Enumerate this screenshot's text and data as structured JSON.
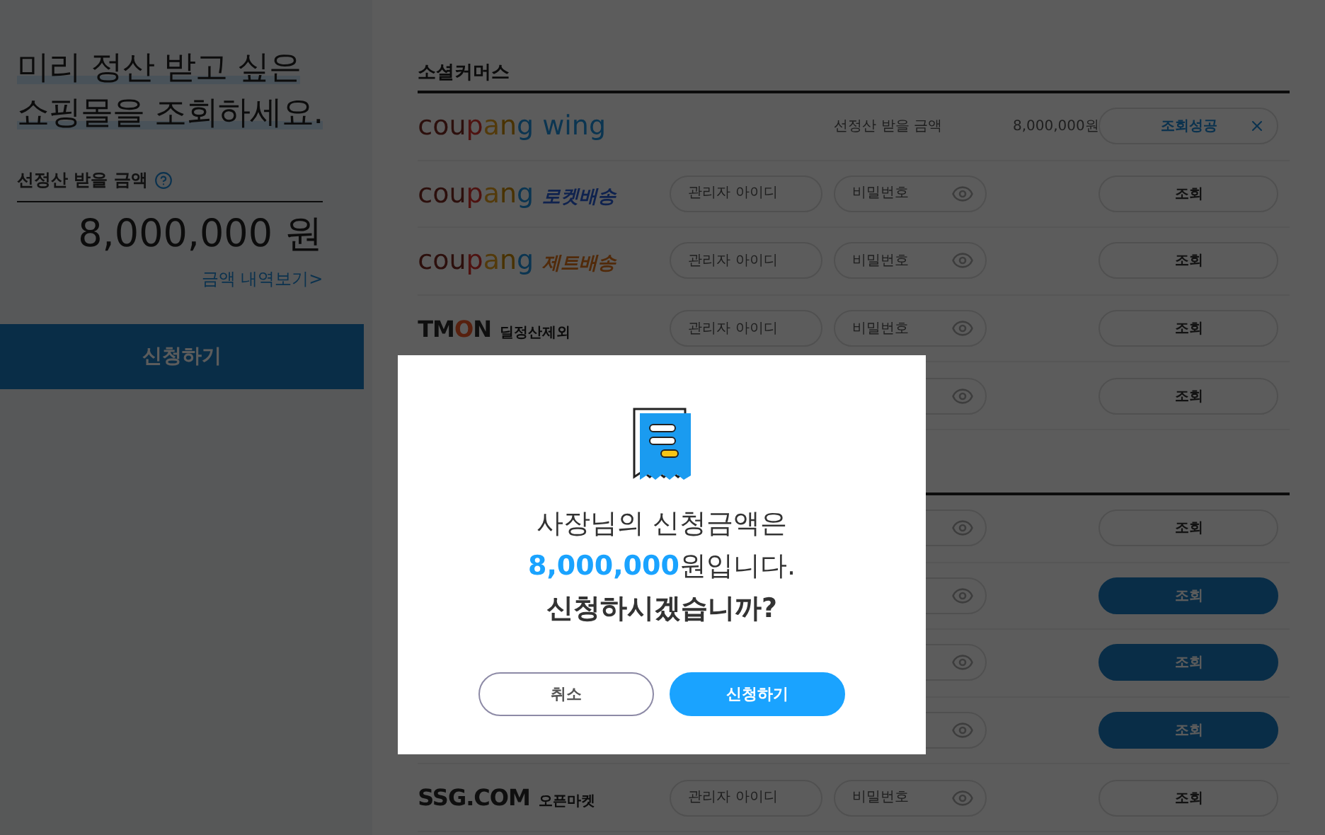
{
  "sidebar": {
    "title_lines": [
      "미리 정산 받고 싶은",
      "쇼핑몰을 조회하세요."
    ],
    "amount_label": "선정산 받을 금액",
    "amount": "8,000,000 원",
    "details_link": "금액 내역보기>",
    "apply_button": "신청하기"
  },
  "sections": [
    {
      "title": "소셜커머스",
      "rows": [
        {
          "kind": "result",
          "logo": {
            "kind": "coupang",
            "name": "coupang",
            "tag": {
              "kind": "wing",
              "text": "wing"
            }
          },
          "label": "선정산 받을 금액",
          "amount": "8,000,000원",
          "button": "조회성공",
          "highlighted": false
        },
        {
          "kind": "login",
          "logo": {
            "kind": "coupang",
            "name": "coupang",
            "tag": {
              "kind": "rocket",
              "text": "로켓배송"
            }
          },
          "id_placeholder": "관리자 아이디",
          "pw_placeholder": "비밀번호",
          "button": "조회",
          "highlighted": false
        },
        {
          "kind": "login",
          "logo": {
            "kind": "coupang",
            "name": "coupang",
            "tag": {
              "kind": "jet",
              "text": "제트배송"
            }
          },
          "id_placeholder": "관리자 아이디",
          "pw_placeholder": "비밀번호",
          "button": "조회",
          "highlighted": false
        },
        {
          "kind": "login",
          "logo": {
            "kind": "tmon",
            "name": "TMON",
            "tag": {
              "kind": "plain",
              "text": "딜정산제외"
            }
          },
          "id_placeholder": "관리자 아이디",
          "pw_placeholder": "비밀번호",
          "button": "조회",
          "highlighted": false
        },
        {
          "kind": "login",
          "button": "조회",
          "highlighted": false
        }
      ]
    },
    {
      "rows": [
        {
          "kind": "login",
          "button": "조회",
          "highlighted": false
        },
        {
          "kind": "login",
          "button": "조회",
          "highlighted": true
        },
        {
          "kind": "login",
          "button": "조회",
          "highlighted": true
        },
        {
          "kind": "login",
          "button": "조회",
          "highlighted": true
        },
        {
          "kind": "login",
          "logo": {
            "kind": "ssg",
            "name": "SSG.COM",
            "tag": {
              "kind": "plain",
              "text": "오픈마켓"
            }
          },
          "id_placeholder": "관리자 아이디",
          "pw_placeholder": "비밀번호",
          "button": "조회",
          "highlighted": false
        }
      ]
    }
  ],
  "dialog": {
    "line1": "사장님의 신청금액은",
    "line2": "**8,000,000**원입니다.",
    "line3": "신청하시겠습니까?",
    "cancel_button": "취소",
    "confirm_button": "신청하기"
  }
}
